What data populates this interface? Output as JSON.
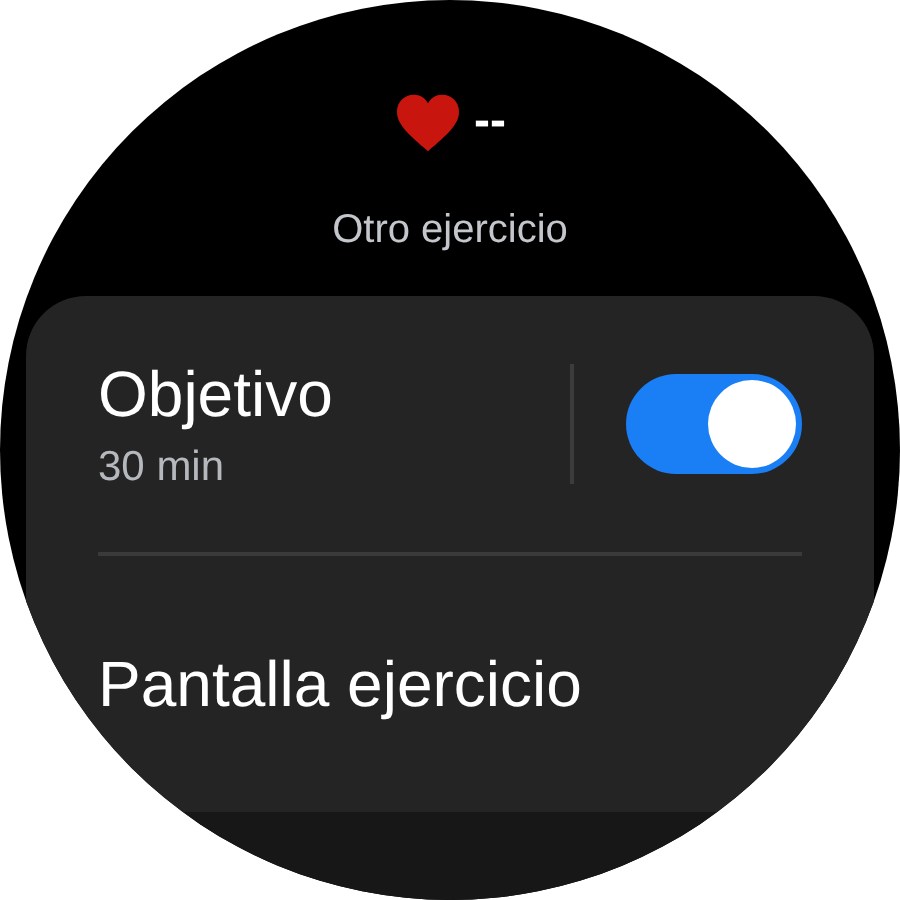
{
  "header": {
    "heart_rate": "--",
    "title": "Otro ejercicio"
  },
  "settings": [
    {
      "kind": "toggle",
      "label": "Objetivo",
      "value": "30 min",
      "on": true
    },
    {
      "kind": "link",
      "label": "Pantalla ejercicio"
    }
  ]
}
